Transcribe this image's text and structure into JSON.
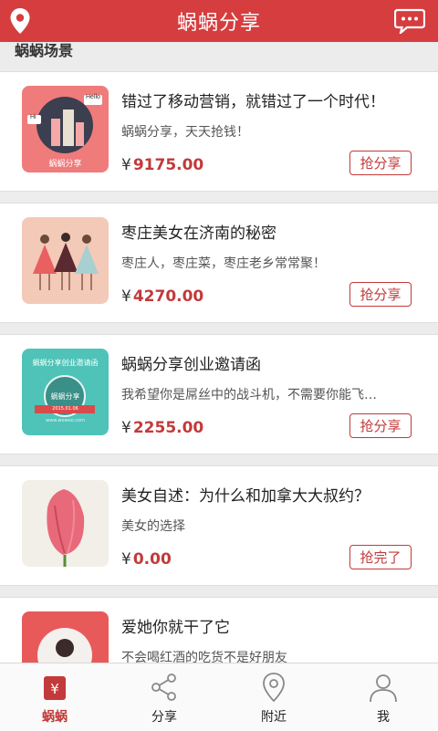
{
  "header": {
    "title": "蜗蜗分享"
  },
  "section": {
    "title": "蜗蜗场景"
  },
  "items": [
    {
      "title": "错过了移动营销，就错过了一个时代！",
      "subtitle": "蜗蜗分享，天天抢钱！",
      "price": "9175.00",
      "button": "抢分享",
      "thumb_caption": "蜗蜗分享",
      "thumb_bubble1": "Hello",
      "thumb_bubble2": "Hi"
    },
    {
      "title": "枣庄美女在济南的秘密",
      "subtitle": "枣庄人，枣庄菜，枣庄老乡常常聚！",
      "price": "4270.00",
      "button": "抢分享"
    },
    {
      "title": "蜗蜗分享创业邀请函",
      "subtitle": "我希望你是屌丝中的战斗机，不需要你能飞…",
      "price": "2255.00",
      "button": "抢分享",
      "thumb_caption": "蜗蜗分享创业邀请函",
      "thumb_badge": "蜗蜗分享",
      "thumb_date": "2015.01.06",
      "thumb_url": "www.wowoo.com"
    },
    {
      "title": "美女自述：为什么和加拿大大叔约？",
      "subtitle": "美女的选择",
      "price": "0.00",
      "button": "抢完了"
    },
    {
      "title": "爱她你就干了它",
      "subtitle": "不会喝红酒的吃货不是好朋友",
      "price": "",
      "button": ""
    }
  ],
  "currency": "¥",
  "tabs": [
    {
      "label": "蜗蜗",
      "icon": "wallet-icon",
      "active": true
    },
    {
      "label": "分享",
      "icon": "share-icon"
    },
    {
      "label": "附近",
      "icon": "location-icon"
    },
    {
      "label": "我",
      "icon": "user-icon"
    }
  ],
  "colors": {
    "brand": "#d63d3f",
    "price": "#c23a3a"
  }
}
